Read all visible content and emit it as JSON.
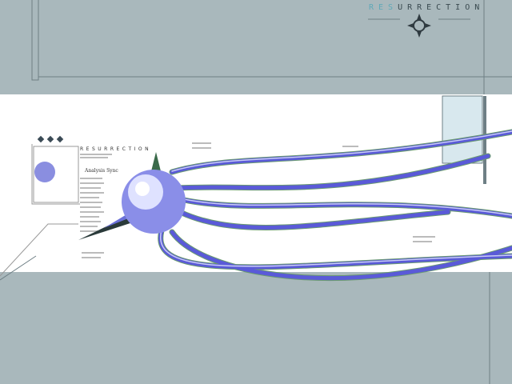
{
  "header": {
    "title_highlight": "RES",
    "title_rest": "URRECTION"
  },
  "panel": {
    "title": "RESURRECTION",
    "section_label": "Analysis Sync"
  },
  "colors": {
    "background": "#a9b8bc",
    "band": "#ffffff",
    "accent": "#5fa9b8",
    "tendril": "#5a5ad8"
  },
  "icons": [
    "emblem-icon",
    "diamond-icon",
    "diamond-icon",
    "diamond-icon"
  ]
}
